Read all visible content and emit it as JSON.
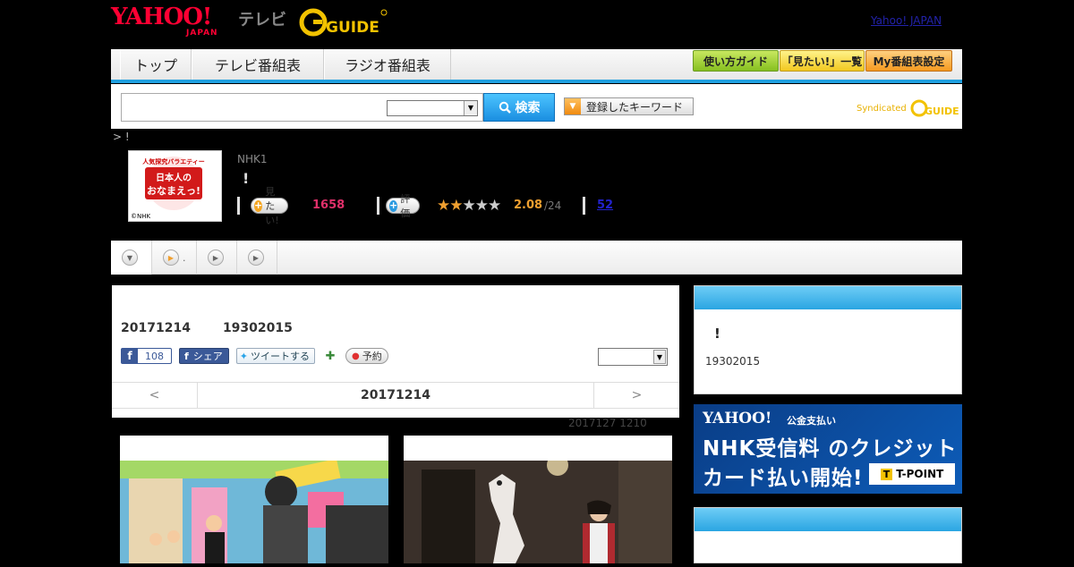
{
  "header": {
    "yahoo_logo": "YAHOO!",
    "japan_logo": "JAPAN",
    "tv_label": "テレビ",
    "gguide_logo": "G GUIDE",
    "top_link": "Yahoo! JAPAN"
  },
  "nav": {
    "tabs": [
      "トップ",
      "テレビ番組表",
      "ラジオ番組表"
    ],
    "buttons": [
      "使い方ガイド",
      "「見たい!」一覧",
      "My番組表設定"
    ]
  },
  "search": {
    "input_value": "",
    "select_value": "",
    "button_label": "検索",
    "keyword_button": "登録したキーワード",
    "syndicated_label": "Syndicated"
  },
  "program": {
    "breadcrumb": "> !",
    "logo_text": "日本人のおなまえっ!",
    "logo_subtext": "人気探究バラエティー",
    "logo_credit": "©NHK",
    "channel": "NHK1",
    "title": "!",
    "mitai_label": "見たい!",
    "mitai_count": "1658",
    "hyoka_label": "評価",
    "rating": "2.08",
    "rating_total": "/24",
    "review_count": "52"
  },
  "tabs_strip": {
    "tab2_suffix": "."
  },
  "main": {
    "date": "20171214",
    "time": "19302015",
    "fb_count": "108",
    "fb_share": "シェア",
    "tweet": "ツイートする",
    "reserve": "予約",
    "select_value": "",
    "nav_prev": "<",
    "nav_date": "20171214",
    "nav_next": ">",
    "update_note": "2017127  1210"
  },
  "side": {
    "box1_title": "!",
    "box1_time": "19302015",
    "banner_logo": "YAHOO!",
    "banner_sub": "公金支払い",
    "banner_line1": "NHK受信料 のクレジット",
    "banner_line2": "カード払い開始!",
    "banner_tpoint": "T-POINT"
  },
  "colors": {
    "accent_blue": "#20a0e0",
    "yahoo_red": "#ff0033",
    "mitai_pink": "#e0306a",
    "rating_orange": "#f0a030"
  }
}
